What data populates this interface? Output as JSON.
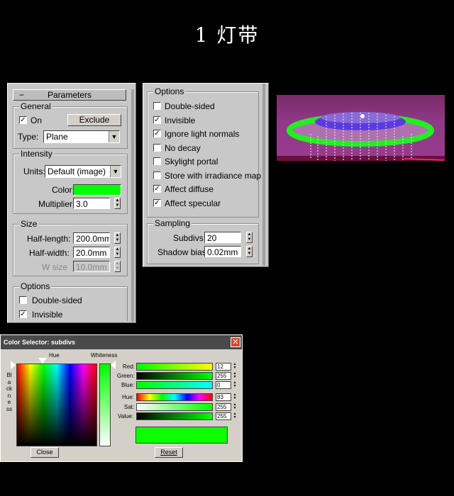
{
  "page_title": "1 灯带",
  "parameters_panel": {
    "rollout_label": "Parameters",
    "rollout_toggle": "−",
    "general": {
      "label": "General",
      "on_label": "On",
      "on_checked": true,
      "exclude_label": "Exclude",
      "type_label": "Type:",
      "type_value": "Plane"
    },
    "intensity": {
      "label": "Intensity",
      "units_label": "Units:",
      "units_value": "Default (image)",
      "color_label": "Color:",
      "color_value": "#00ff00",
      "multiplier_label": "Multiplier:",
      "multiplier_value": "3.0"
    },
    "size": {
      "label": "Size",
      "half_length_label": "Half-length:",
      "half_length_value": "200.0mm",
      "half_width_label": "Half-width:",
      "half_width_value": "20.0mm",
      "w_size_label": "W size",
      "w_size_value": "10.0mm"
    },
    "options": {
      "label": "Options",
      "double_sided_label": "Double-sided",
      "double_sided_checked": false,
      "invisible_label": "Invisible",
      "invisible_checked": true
    }
  },
  "options_panel": {
    "label": "Options",
    "items": [
      {
        "label": "Double-sided",
        "checked": false
      },
      {
        "label": "Invisible",
        "checked": true
      },
      {
        "label": "Ignore light normals",
        "checked": true
      },
      {
        "label": "No decay",
        "checked": false
      },
      {
        "label": "Skylight portal",
        "checked": false
      },
      {
        "label": "Store with irradiance map",
        "checked": false
      },
      {
        "label": "Affect diffuse",
        "checked": true
      },
      {
        "label": "Affect specular",
        "checked": true
      }
    ],
    "sampling": {
      "label": "Sampling",
      "subdivs_label": "Subdivs:",
      "subdivs_value": "20",
      "shadow_bias_label": "Shadow bias:",
      "shadow_bias_value": "0.02mm"
    }
  },
  "color_selector": {
    "title": "Color Selector: subdivs",
    "close_icon": "close-icon",
    "hue_label": "Hue",
    "whiteness_label": "Whiteness",
    "blackness_label": "Blackness",
    "red_label": "Red:",
    "red_value": "12",
    "green_label": "Green:",
    "green_value": "255",
    "blue_label": "Blue:",
    "blue_value": "0",
    "hue_slider_label": "Hue:",
    "hue_value": "83",
    "sat_label": "Sat:",
    "sat_value": "255",
    "value_label": "Value:",
    "value_value": "255",
    "swatch_color": "#0cff00",
    "close_button": "Close",
    "reset_button": "Reset"
  },
  "colors": {
    "panel_bg": "#c8c8c8",
    "accent_green": "#00ff00"
  }
}
